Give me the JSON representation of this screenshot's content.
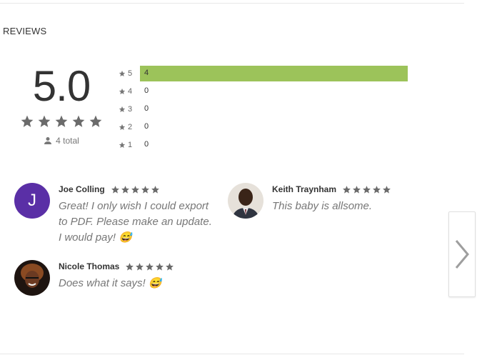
{
  "section": {
    "title": "REVIEWS"
  },
  "rating": {
    "score": "5.0",
    "stars": 5,
    "total_text": "4 total"
  },
  "histogram": [
    {
      "stars": "5",
      "count": "4",
      "fraction": 1.0
    },
    {
      "stars": "4",
      "count": "0",
      "fraction": 0
    },
    {
      "stars": "3",
      "count": "0",
      "fraction": 0
    },
    {
      "stars": "2",
      "count": "0",
      "fraction": 0
    },
    {
      "stars": "1",
      "count": "0",
      "fraction": 0
    }
  ],
  "reviews": [
    {
      "name": "Joe Colling",
      "avatar_letter": "J",
      "stars": 5,
      "text": "Great! I only wish I could export to PDF. Please make an update. I would pay! 😅"
    },
    {
      "name": "Keith Traynham",
      "stars": 5,
      "text": "This baby is allsome."
    },
    {
      "name": "Nicole Thomas",
      "stars": 5,
      "text": "Does what it says! 😅"
    }
  ],
  "colors": {
    "bar": "#9cc35a",
    "star": "#6b6b6b",
    "avatar_letter_bg": "#5a2fa6"
  },
  "icons": {
    "star": "star-icon",
    "person": "person-icon",
    "next": "chevron-right-icon"
  }
}
